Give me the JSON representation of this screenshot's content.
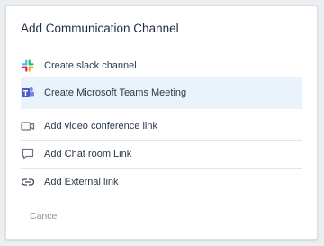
{
  "dialog": {
    "title": "Add Communication Channel",
    "items": [
      {
        "label": "Create slack channel",
        "icon": "slack-icon"
      },
      {
        "label": "Create Microsoft Teams Meeting",
        "icon": "microsoft-teams-icon"
      },
      {
        "label": "Add video conference link",
        "icon": "video-camera-icon"
      },
      {
        "label": "Add Chat room Link",
        "icon": "chat-bubble-icon"
      },
      {
        "label": "Add External link",
        "icon": "link-icon"
      }
    ],
    "cancel_label": "Cancel"
  },
  "colors": {
    "highlight_row": "#eaf2fb",
    "teams_brand": "#5059c9",
    "icon_gray": "#6b7684"
  }
}
